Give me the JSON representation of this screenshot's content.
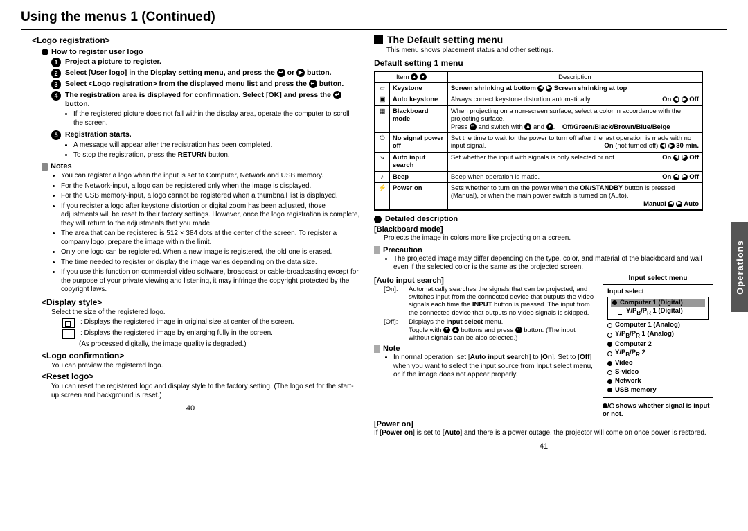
{
  "page_title": "Using the menus 1 (Continued)",
  "side_tab": "Operations",
  "left": {
    "logo_reg": "<Logo registration>",
    "how_to": "How to register user logo",
    "steps": [
      "Project a picture to register.",
      "Select [User logo] in the Display setting menu, and press the ↵ or ▶ button.",
      "Select <Logo registration> from the displayed menu list and press the ↵ button.",
      "The registration area is displayed for confirmation. Select [OK] and press the ↵ button.",
      "Registration starts."
    ],
    "step4_notes": [
      "If the registered picture does not fall within the display area, operate the computer to scroll the screen."
    ],
    "step5_notes": [
      "A message will appear after the registration has been completed.",
      "To stop the registration, press the RETURN button."
    ],
    "notes_h": "Notes",
    "notes": [
      "You can register a logo when the input is set to Computer, Network and USB memory.",
      "For the Network-input, a logo can be registered only when the image is displayed.",
      "For the USB memory-input, a logo cannot be registered when a thumbnail list is displayed.",
      "If you register a logo after keystone distortion or digital zoom has been adjusted, those adjustments will be reset to their factory settings. However, once the logo registration is complete, they will return to the adjustments that you made.",
      "The area that can be registered is 512 × 384 dots at the center of the screen. To register a company logo, prepare the image within the limit.",
      "Only one logo can be registered. When a new image is registered, the old one is erased.",
      "The time needed to register or display the image varies depending on the data size.",
      "If you use this function on commercial video software, broadcast or cable-broadcasting except for the purpose of your private viewing and listening, it may infringe the copyright protected by the copyright laws."
    ],
    "disp_style": "<Display style>",
    "disp_style_text": "Select the size of the registered logo.",
    "disp_style_opt1": ": Displays the registered image in original size at center of the screen.",
    "disp_style_opt2": ": Displays the registered image by enlarging fully in the screen.",
    "disp_style_opt2_sub": "(As processed digitally, the image quality is degraded.)",
    "logo_conf": "<Logo confirmation>",
    "logo_conf_text": "You can preview the registered logo.",
    "reset_logo": "<Reset logo>",
    "reset_logo_text": "You can reset the registered logo and display style to the factory setting. (The logo set for the start-up screen and background is reset.)",
    "page_num": "40"
  },
  "right": {
    "sec_h": "The Default setting menu",
    "sec_sub": "This menu shows placement status and other settings.",
    "sec_h2": "Default setting 1 menu",
    "tbl_hdr_item": "Item",
    "tbl_hdr_desc": "Description",
    "rows": [
      {
        "item": "Keystone",
        "desc": "Screen shrinking at bottom ◀ ▶ Screen shrinking at top",
        "bold": true
      },
      {
        "item": "Auto keystone",
        "desc": "Always correct keystone distortion automatically.",
        "right": "On ◀ ▶ Off"
      },
      {
        "item": "Blackboard mode",
        "desc": "When projecting on a non-screen surface, select a color in accordance with the projecting surface.",
        "extra": "Press ↵ and switch with ▲ and ▼.     Off/Green/Black/Brown/Blue/Beige"
      },
      {
        "item": "No signal power off",
        "desc": "Set the time to wait for the power to turn off after the last operation is made with no input signal.",
        "right": "On (not turned off) ◀ ▶ 30 min."
      },
      {
        "item": "Auto input search",
        "desc": "Set whether the input with signals is only selected or not.",
        "right": "On ◀ ▶ Off"
      },
      {
        "item": "Beep",
        "desc": "Beep when operation is made.",
        "right": "On ◀ ▶ Off"
      },
      {
        "item": "Power on",
        "desc": "Sets whether to turn on the power when the ON/STANDBY button is pressed (Manual), or when the main power switch is turned on (Auto).",
        "right": "Manual ◀ ▶ Auto"
      }
    ],
    "detail_h": "Detailed description",
    "bb_h": "[Blackboard mode]",
    "bb_text": "Projects the image in colors more like projecting on a screen.",
    "prec_h": "Precaution",
    "prec_text": "The projected image may differ depending on the type, color, and material of the blackboard and wall even if the selected color is the same as the projected screen.",
    "ais_h": "[Auto input search]",
    "ais_on_lbl": "[On]:",
    "ais_on": "Automatically searches the signals that can be projected, and switches input from the connected device that outputs the video signals each time the INPUT button is pressed. The input from the connected device that outputs no video signals is skipped.",
    "ais_off_lbl": "[Off]:",
    "ais_off": "Displays the Input select menu.",
    "ais_off2": "Toggle with ▼ ▲ buttons and press ↵ button. (The input without signals can be also selected.)",
    "note_h": "Note",
    "note_text": "In normal operation, set [Auto input search] to [On]. Set to [Off] when you want to select the input source from Input select menu, or if the image does not appear properly.",
    "po_h": "[Power on]",
    "po_text": "If [Power on] is set to [Auto] and there is a power outage, the projector will come on once power is restored.",
    "inp_title": "Input select menu",
    "inp_hdr": "Input select",
    "inp_items": [
      {
        "label": "Computer 1 (Digital)",
        "fill": true,
        "highlight": true
      },
      {
        "label": "Y/PB/PR 1 (Digital)",
        "fill": false,
        "indent": true
      },
      {
        "label": "Computer 1 (Analog)",
        "fill": false
      },
      {
        "label": "Y/PB/PR 1 (Analog)",
        "fill": false
      },
      {
        "label": "Computer 2",
        "fill": true
      },
      {
        "label": "Y/PB/PR 2",
        "fill": false
      },
      {
        "label": "Video",
        "fill": true
      },
      {
        "label": "S-video",
        "fill": false
      },
      {
        "label": "Network",
        "fill": true
      },
      {
        "label": "USB memory",
        "fill": true
      }
    ],
    "inp_footer": "●/○ shows whether signal is input or not.",
    "page_num": "41"
  }
}
